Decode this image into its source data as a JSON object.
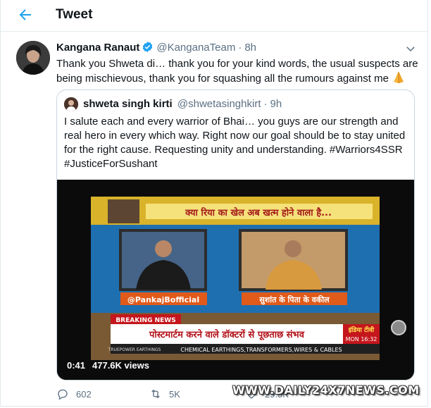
{
  "header": {
    "title": "Tweet",
    "back_icon": "back-arrow-icon"
  },
  "tweet": {
    "author_name": "Kangana Ranaut",
    "handle": "@KanganaTeam",
    "separator": "·",
    "time": "8h",
    "text": "Thank you Shweta di… thank you for your kind words, the usual suspects are being mischievous, thank you for squashing all the rumours against me"
  },
  "quote": {
    "author_name": "shweta singh kirti",
    "handle": "@shwetasinghkirt",
    "separator": "·",
    "time": "9h",
    "text": "I salute each and every warrior of Bhai… you guys are our strength and real hero in every which way. Right now our goal should be to stay united for the right cause. Requesting unity and understanding. #Warriors4SSR #JusticeForSushant",
    "video": {
      "duration": "0:41",
      "views": "477.6K views",
      "headline_banner": "क्या रिया का खेल अब खत्म होने वाला है...",
      "left_guest_label": "@PankajBofficial",
      "right_guest_label": "सुशांत के पिता के वकील",
      "breaking_tag": "BREAKING NEWS",
      "ticker_main": "पोस्टमार्टम करने वाले डॉक्टरों से पूछताछ संभव",
      "ticker_bottom": "CHEMICAL EARTHINGS,TRANSFORMERS,WIRES & CABLES",
      "sponsor": "TRUEPOWER EARTHINGS",
      "channel": "इंडिया टीवी",
      "clock": "MON 16:32"
    }
  },
  "actions": {
    "replies": "602",
    "retweets": "5K",
    "likes": "29.5K"
  },
  "watermark": "WWW.DAILY24X7NEWS.COM",
  "colors": {
    "accent": "#1da1f2",
    "muted": "#5b7083",
    "border": "#ccd6dd"
  }
}
